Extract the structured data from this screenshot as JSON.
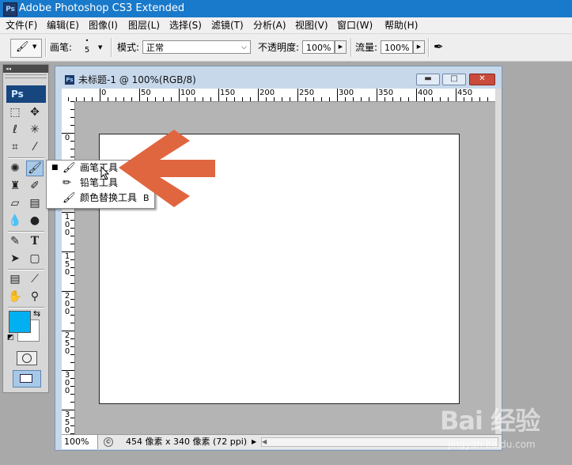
{
  "app": {
    "title": "Adobe Photoshop CS3 Extended",
    "logo": "Ps"
  },
  "menu": [
    "文件(F)",
    "编辑(E)",
    "图像(I)",
    "图层(L)",
    "选择(S)",
    "滤镜(T)",
    "分析(A)",
    "视图(V)",
    "窗口(W)",
    "帮助(H)"
  ],
  "options": {
    "brush_label": "画笔:",
    "brush_size": "5",
    "brush_dot": "•",
    "mode_label": "模式:",
    "mode_value": "正常",
    "opacity_label": "不透明度:",
    "opacity_value": "100%",
    "flow_label": "流量:",
    "flow_value": "100%"
  },
  "toolbox": {
    "collapse": "◂◂",
    "logo": "Ps"
  },
  "document": {
    "title": "未标题-1 @ 100%(RGB/8)",
    "zoom": "100%",
    "dimensions": "454 像素 x 340 像素 (72 ppi)",
    "ruler_top": [
      "0",
      "50",
      "100",
      "150",
      "200",
      "250",
      "300",
      "350",
      "400",
      "450"
    ],
    "ruler_left": [
      "0",
      "5\n0",
      "1\n0\n0",
      "1\n5\n0",
      "2\n0\n0",
      "2\n5\n0",
      "3\n0\n0",
      "3\n5\n0"
    ]
  },
  "flyout": {
    "items": [
      {
        "label": "画笔工具",
        "key": "",
        "selected": true
      },
      {
        "label": "铅笔工具",
        "key": "",
        "selected": false
      },
      {
        "label": "颜色替换工具",
        "key": "B",
        "selected": false
      }
    ]
  },
  "colors": {
    "foreground": "#00b0f0",
    "background": "#ffffff",
    "arrow": "#e0663f",
    "titlebar": "#1979ca"
  },
  "watermark": {
    "main": "Bai 经验",
    "sub": "jingyan.baidu.com"
  }
}
